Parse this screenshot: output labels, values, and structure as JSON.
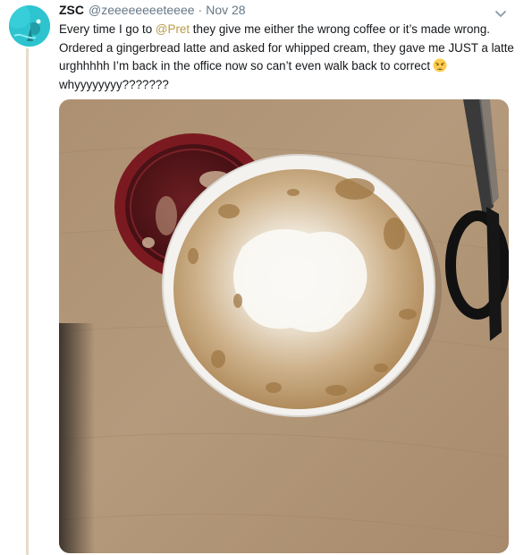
{
  "tweet": {
    "author_name": "ZSC",
    "author_handle": "@zeeeeeeeeteeee",
    "separator": "·",
    "timestamp": "Nov 28",
    "text": {
      "part1": "Every time I go to ",
      "mention": "@Pret",
      "part2": " they give me either the wrong coffee or it’s made wrong. Ordered a gingerbread latte and asked for whipped cream, they gave me JUST a latte urghhhhh I’m back in the office now so can’t even walk back to correct",
      "part3": " whyyyyyyyy???????"
    },
    "emoji": "weary-face-icon",
    "mention_color": "#b99a49",
    "avatar_color": "#2ec4cf",
    "thread_line_color": "#e6dcc6"
  }
}
